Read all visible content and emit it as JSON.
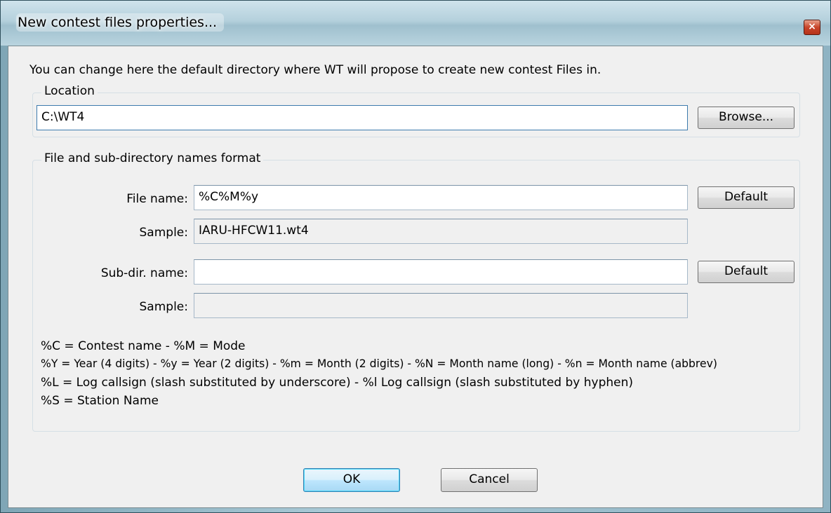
{
  "window": {
    "title": "New contest files properties...",
    "close_glyph": "×"
  },
  "intro": "You can change here the default directory where WT will propose to create new contest Files in.",
  "location": {
    "group_label": "Location",
    "path_value": "C:\\WT4",
    "browse_label": "Browse..."
  },
  "format": {
    "group_label": "File and sub-directory names format",
    "file_name_label": "File name:",
    "file_name_value": "%C%M%y",
    "file_default_label": "Default",
    "file_sample_label": "Sample:",
    "file_sample_value": "IARU-HFCW11.wt4",
    "subdir_label": "Sub-dir. name:",
    "subdir_value": "",
    "subdir_default_label": "Default",
    "subdir_sample_label": "Sample:",
    "subdir_sample_value": "",
    "legend": [
      "%C = Contest name - %M = Mode",
      "%Y = Year (4 digits) - %y = Year (2 digits) - %m = Month (2 digits) - %N = Month name (long) - %n = Month name (abbrev)",
      "%L = Log callsign (slash substituted by underscore) - %l Log callsign (slash substituted by hyphen)",
      "%S = Station Name"
    ]
  },
  "buttons": {
    "ok_label": "OK",
    "cancel_label": "Cancel"
  }
}
